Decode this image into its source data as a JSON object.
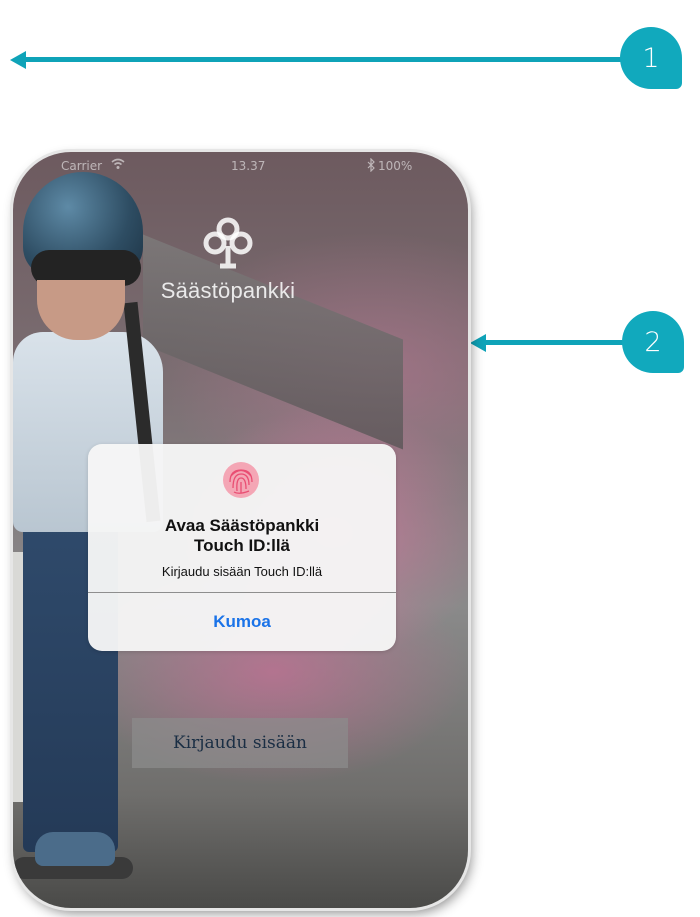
{
  "callouts": {
    "first": "1",
    "second": "2",
    "color": "#11a9bd"
  },
  "status_bar": {
    "carrier": "Carrier",
    "time": "13.37",
    "battery": "100%"
  },
  "logo": {
    "icon": "tree-icon",
    "text": "Säästöpankki"
  },
  "touch_id_alert": {
    "icon": "fingerprint-icon",
    "title": "Avaa Säästöpankki\nTouch ID:llä",
    "message": "Kirjaudu sisään Touch ID:llä",
    "cancel_label": "Kumoa",
    "cancel_color": "#1a73e8"
  },
  "login_button": {
    "label": "Kirjaudu sisään"
  }
}
